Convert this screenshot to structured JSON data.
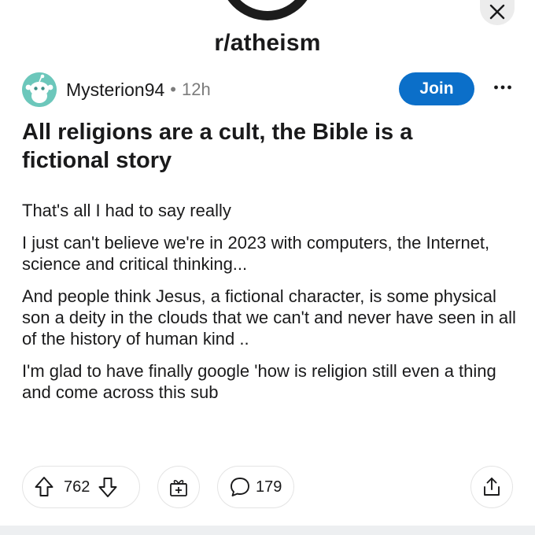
{
  "community": {
    "name": "r/atheism",
    "icon": "community-icon"
  },
  "post": {
    "author": "Mysterion94",
    "separator": "•",
    "age": "12h",
    "join_label": "Join",
    "title": "All religions are a cult, the Bible is a fictional story",
    "body": [
      "That's all I had to say really",
      "I just can't believe we're in 2023 with computers, the Internet, science and critical thinking...",
      "And people think Jesus, a fictional character, is some physical son a deity in the clouds that we can't and never have seen in all of the history of human kind ..",
      "I'm glad to have finally google 'how is religion still even a thing and come across this sub"
    ]
  },
  "actions": {
    "upvotes": "762",
    "comments": "179"
  },
  "icons": {
    "close": "close-icon",
    "more": "more-options-icon",
    "upvote": "upvote-arrow-icon",
    "downvote": "downvote-arrow-icon",
    "award": "award-gift-icon",
    "comment": "comment-bubble-icon",
    "share": "share-icon"
  },
  "colors": {
    "accent": "#0b6fc9",
    "avatar_bg": "#6cc7bb",
    "text": "#1a1a1b",
    "muted": "#7c7c7c"
  }
}
